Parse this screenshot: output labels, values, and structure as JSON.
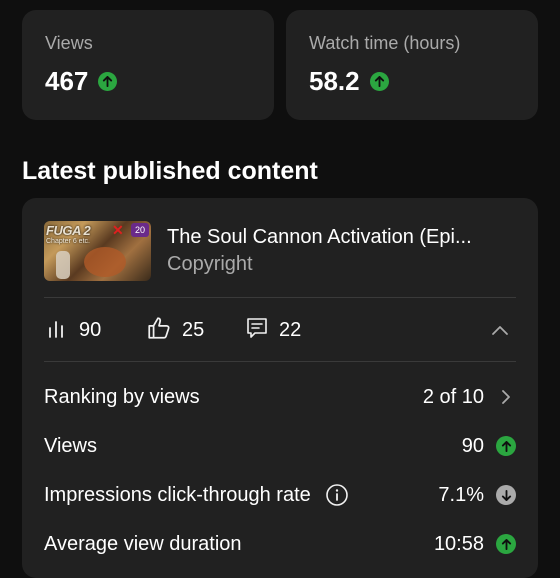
{
  "stats": {
    "views": {
      "label": "Views",
      "value": "467",
      "trend": "up"
    },
    "watch_time": {
      "label": "Watch time (hours)",
      "value": "58.2",
      "trend": "up"
    }
  },
  "section": {
    "title": "Latest published content"
  },
  "video": {
    "title": "The Soul Cannon Activation (Epi...",
    "subtitle": "Copyright",
    "thumbnail": {
      "title_text": "FUGA 2",
      "sub_text": "Chapter 6 etc.",
      "badge": "20"
    }
  },
  "metrics": {
    "views": "90",
    "likes": "25",
    "comments": "22"
  },
  "details": {
    "ranking": {
      "label": "Ranking by views",
      "value": "2 of 10"
    },
    "views": {
      "label": "Views",
      "value": "90",
      "trend": "up"
    },
    "ctr": {
      "label": "Impressions click-through rate",
      "value": "7.1%",
      "trend": "down"
    },
    "avd": {
      "label": "Average view duration",
      "value": "10:58",
      "trend": "up"
    }
  },
  "colors": {
    "background": "#0f0f0f",
    "card": "#212121",
    "up": "#2ba640",
    "down": "#aaaaaa",
    "muted_text": "#aaaaaa"
  },
  "icons": [
    "arrow-up-icon",
    "arrow-down-icon",
    "bar-chart-icon",
    "thumbs-up-icon",
    "comment-icon",
    "chevron-up-icon",
    "chevron-right-icon",
    "info-icon"
  ]
}
